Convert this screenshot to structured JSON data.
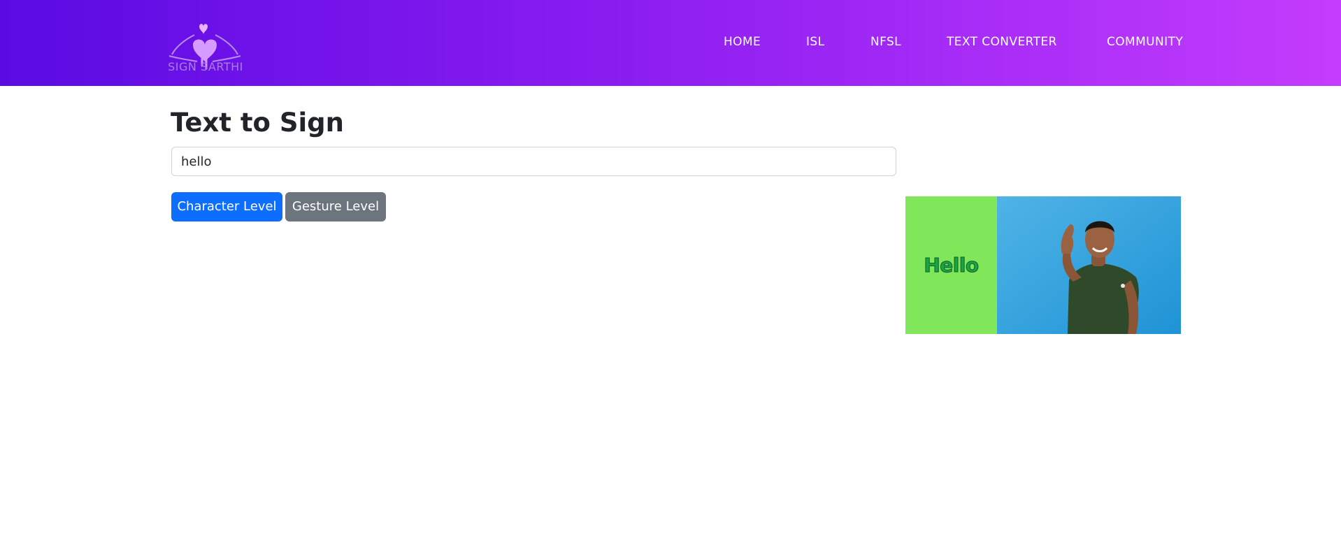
{
  "brand": {
    "logo_text": "SIGN SARTHI"
  },
  "nav": {
    "items": [
      {
        "label": "HOME"
      },
      {
        "label": "ISL"
      },
      {
        "label": "NFSL"
      },
      {
        "label": "TEXT CONVERTER"
      },
      {
        "label": "COMMUNITY"
      }
    ]
  },
  "main": {
    "title": "Text to Sign",
    "input_value": "hello",
    "buttons": {
      "character": "Character Level",
      "gesture": "Gesture Level"
    }
  },
  "media": {
    "word": "Hello"
  },
  "colors": {
    "nav_gradient_start": "#5a0be3",
    "nav_gradient_end": "#c43cfd",
    "primary_button": "#0d6efd",
    "secondary_button": "#6c757d",
    "media_green": "#80e65a",
    "media_blue": "#3aa6dd"
  },
  "icons": {
    "logo": "heart-hands-logo"
  }
}
